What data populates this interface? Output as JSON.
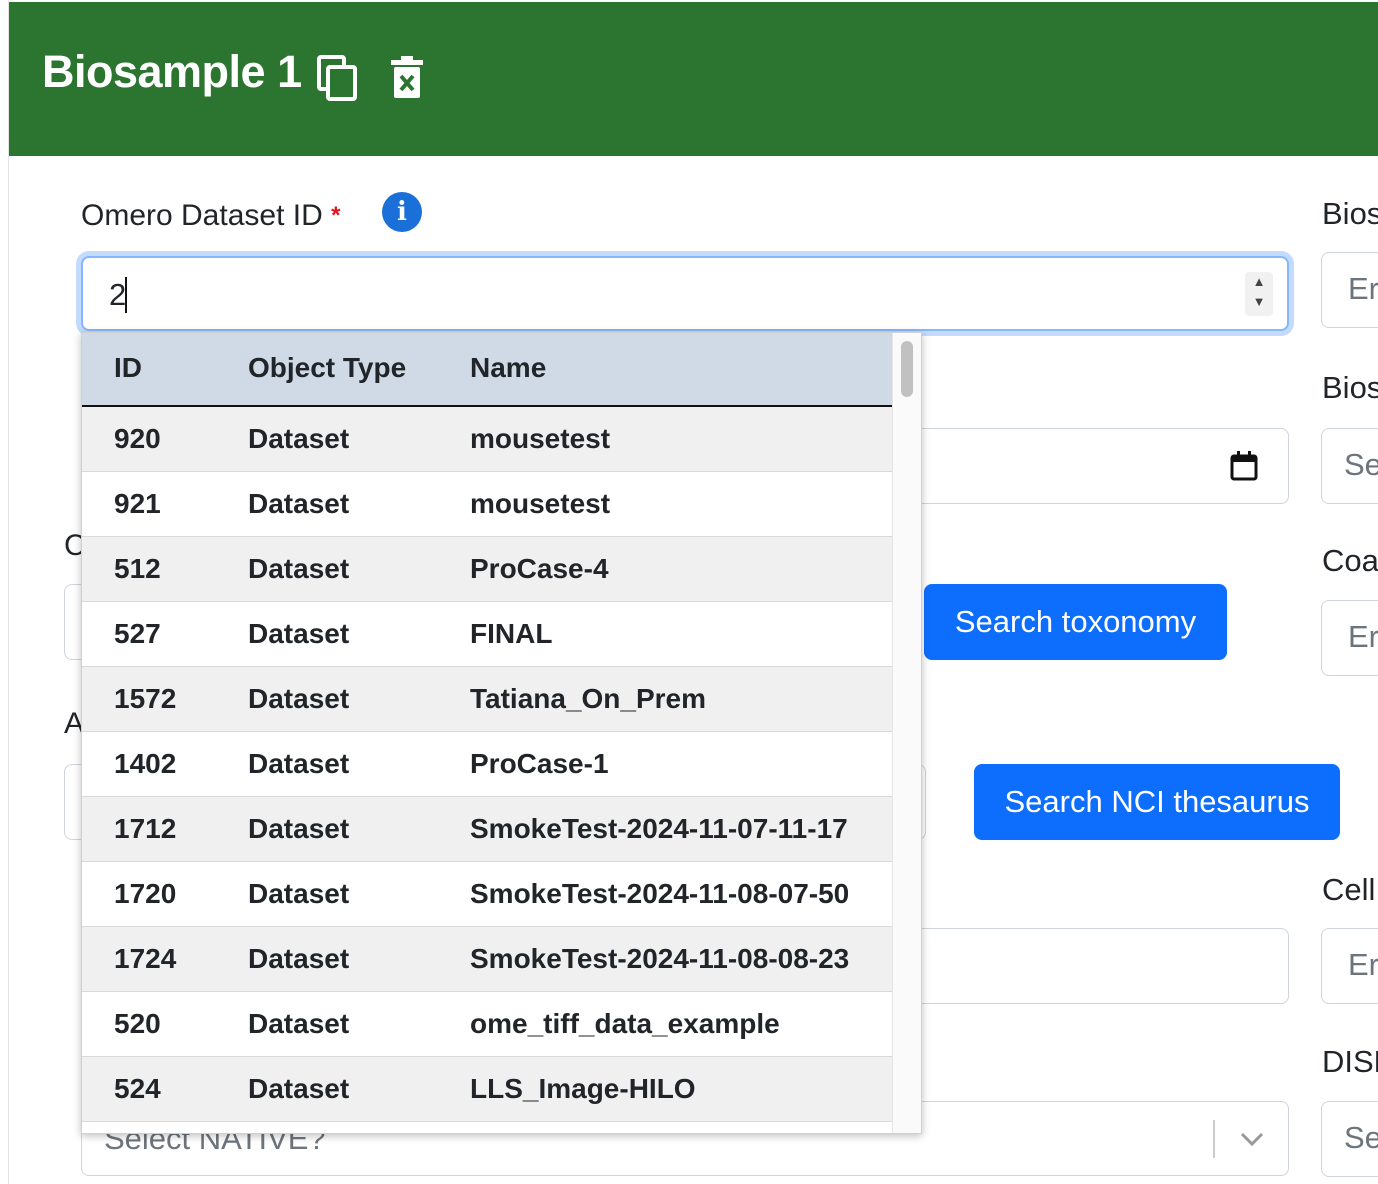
{
  "header": {
    "title": "Biosample 1",
    "copy_icon": "copy-icon",
    "delete_icon": "trash-icon",
    "bg_color": "#2c7531"
  },
  "form": {
    "omero_label": "Omero Dataset ID",
    "required_mark": "*",
    "omero_value": "2",
    "search_taxonomy": "Search toxonomy",
    "search_nci": "Search NCI thesaurus",
    "native_placeholder": "Select NATIVE?",
    "left_cut_labels": [
      "C",
      "A"
    ]
  },
  "right_column": {
    "labels": [
      "Bios",
      "Bios",
      "Coa",
      "Cell",
      "DISE"
    ],
    "placeholders": [
      "Er",
      "Se",
      "Er",
      "Er",
      "Se"
    ]
  },
  "dropdown": {
    "columns": [
      "ID",
      "Object Type",
      "Name"
    ],
    "rows": [
      {
        "id": "920",
        "type": "Dataset",
        "name": "mousetest"
      },
      {
        "id": "921",
        "type": "Dataset",
        "name": "mousetest"
      },
      {
        "id": "512",
        "type": "Dataset",
        "name": "ProCase-4"
      },
      {
        "id": "527",
        "type": "Dataset",
        "name": "FINAL"
      },
      {
        "id": "1572",
        "type": "Dataset",
        "name": "Tatiana_On_Prem"
      },
      {
        "id": "1402",
        "type": "Dataset",
        "name": "ProCase-1"
      },
      {
        "id": "1712",
        "type": "Dataset",
        "name": "SmokeTest-2024-11-07-11-17"
      },
      {
        "id": "1720",
        "type": "Dataset",
        "name": "SmokeTest-2024-11-08-07-50"
      },
      {
        "id": "1724",
        "type": "Dataset",
        "name": "SmokeTest-2024-11-08-08-23"
      },
      {
        "id": "520",
        "type": "Dataset",
        "name": "ome_tiff_data_example"
      },
      {
        "id": "524",
        "type": "Dataset",
        "name": "LLS_Image-HILO"
      }
    ]
  },
  "colors": {
    "accent": "#0d6efd",
    "required": "#e0141e",
    "info": "#1a6fd8"
  }
}
